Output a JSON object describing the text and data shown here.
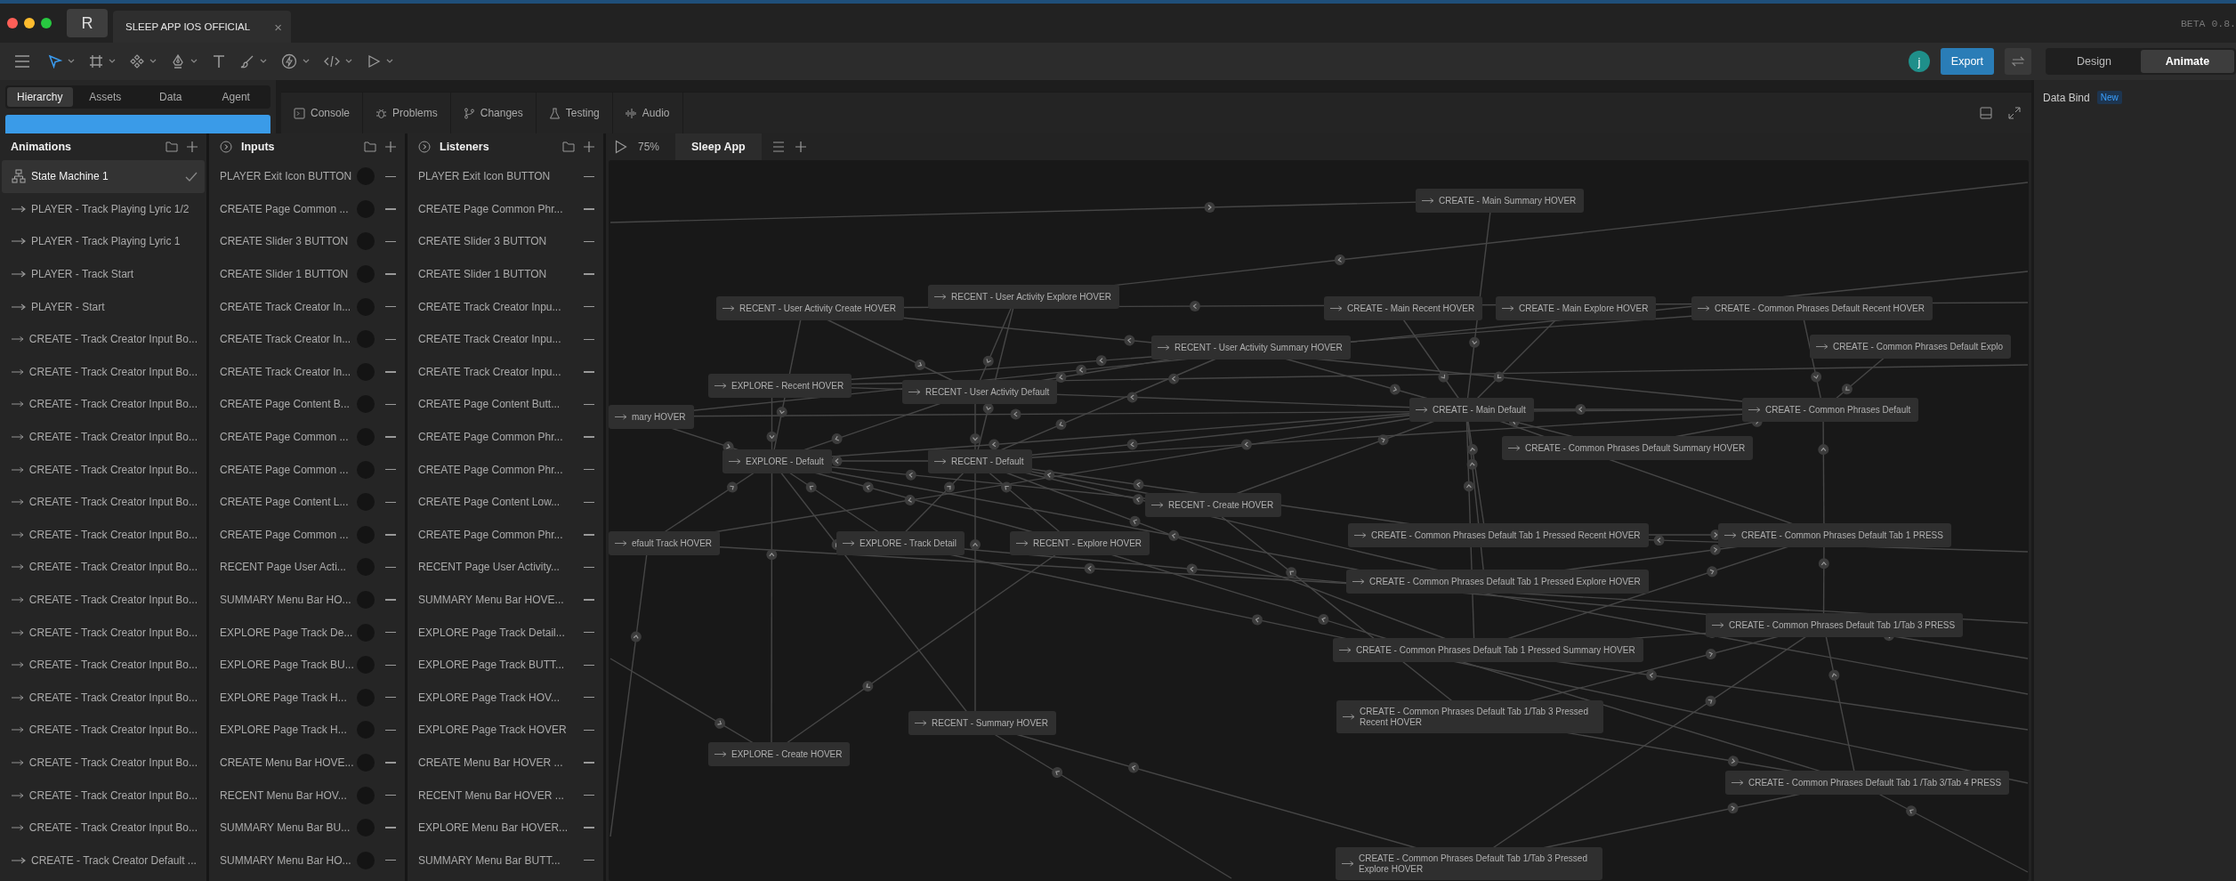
{
  "title_bar": {
    "logo": "R",
    "tab": {
      "title": "SLEEP APP IOS OFFICIAL",
      "close": "×"
    },
    "version": "BETA 0.8."
  },
  "toolbar": {
    "tools": [
      {
        "selected": true
      },
      {
        "selected": false
      },
      {
        "selected": false
      },
      {
        "selected": false
      },
      {
        "selected": false
      },
      {
        "selected": false
      },
      {
        "selected": false
      },
      {
        "selected": false
      },
      {
        "selected": false
      }
    ],
    "avatar": "j",
    "export": "Export",
    "mode_tabs": [
      {
        "label": "Design",
        "selected": false
      },
      {
        "label": "Animate",
        "selected": true
      }
    ]
  },
  "left_tabs": [
    {
      "label": "Hierarchy",
      "selected": true
    },
    {
      "label": "Assets",
      "selected": false
    },
    {
      "label": "Data",
      "selected": false
    },
    {
      "label": "Agent",
      "selected": false
    }
  ],
  "bottom_tabs": [
    "Console",
    "Problems",
    "Changes",
    "Testing",
    "Audio"
  ],
  "right_panel": {
    "title": "Data Bind",
    "badge": "New"
  },
  "animations": {
    "title": "Animations",
    "items": [
      {
        "label": "State Machine 1",
        "kind": "state-machine",
        "selected": true
      },
      {
        "label": "PLAYER - Track Playing Lyric 1/2",
        "kind": "timeline",
        "selected": false
      },
      {
        "label": "PLAYER - Track Playing Lyric 1",
        "kind": "timeline",
        "selected": false
      },
      {
        "label": "PLAYER - Track Start",
        "kind": "timeline",
        "selected": false
      },
      {
        "label": "PLAYER - Start",
        "kind": "timeline",
        "selected": false
      },
      {
        "label": "CREATE - Track Creator Input Bo...",
        "kind": "timeline",
        "selected": false
      },
      {
        "label": "CREATE - Track Creator Input Bo...",
        "kind": "timeline",
        "selected": false
      },
      {
        "label": "CREATE - Track Creator Input Bo...",
        "kind": "timeline",
        "selected": false
      },
      {
        "label": "CREATE - Track Creator Input Bo...",
        "kind": "timeline",
        "selected": false
      },
      {
        "label": "CREATE - Track Creator Input Bo...",
        "kind": "timeline",
        "selected": false
      },
      {
        "label": "CREATE - Track Creator Input Bo...",
        "kind": "timeline",
        "selected": false
      },
      {
        "label": "CREATE - Track Creator Input Bo...",
        "kind": "timeline",
        "selected": false
      },
      {
        "label": "CREATE - Track Creator Input Bo...",
        "kind": "timeline",
        "selected": false
      },
      {
        "label": "CREATE - Track Creator Input Bo...",
        "kind": "timeline",
        "selected": false
      },
      {
        "label": "CREATE - Track Creator Input Bo...",
        "kind": "timeline",
        "selected": false
      },
      {
        "label": "CREATE - Track Creator Input Bo...",
        "kind": "timeline",
        "selected": false
      },
      {
        "label": "CREATE - Track Creator Input Bo...",
        "kind": "timeline",
        "selected": false
      },
      {
        "label": "CREATE - Track Creator Input Bo...",
        "kind": "timeline",
        "selected": false
      },
      {
        "label": "CREATE - Track Creator Input Bo...",
        "kind": "timeline",
        "selected": false
      },
      {
        "label": "CREATE - Track Creator Input Bo...",
        "kind": "timeline",
        "selected": false
      },
      {
        "label": "CREATE - Track Creator Input Bo...",
        "kind": "timeline",
        "selected": false
      },
      {
        "label": "CREATE - Track Creator Default ...",
        "kind": "timeline",
        "selected": false
      }
    ]
  },
  "inputs": {
    "title": "Inputs",
    "items": [
      "PLAYER Exit Icon BUTTON",
      "CREATE Page Common ...",
      "CREATE Slider 3 BUTTON",
      "CREATE Slider 1 BUTTON",
      "CREATE Track Creator In...",
      "CREATE Track Creator In...",
      "CREATE Track Creator In...",
      "CREATE Page Content B...",
      "CREATE Page Common ...",
      "CREATE Page Common ...",
      "CREATE Page Content L...",
      "CREATE Page Common ...",
      "RECENT Page User Acti...",
      "SUMMARY Menu Bar HO...",
      "EXPLORE Page Track De...",
      "EXPLORE Page Track BU...",
      "EXPLORE Page Track H...",
      "EXPLORE Page Track H...",
      "CREATE Menu Bar HOVE...",
      "RECENT Menu Bar HOV...",
      "SUMMARY Menu Bar BU...",
      "SUMMARY Menu Bar HO..."
    ]
  },
  "listeners": {
    "title": "Listeners",
    "items": [
      "PLAYER Exit Icon BUTTON",
      "CREATE Page Common Phr...",
      "CREATE Slider 3 BUTTON",
      "CREATE Slider 1 BUTTON",
      "CREATE Track Creator Inpu...",
      "CREATE Track Creator Inpu...",
      "CREATE Track Creator Inpu...",
      "CREATE Page Content Butt...",
      "CREATE Page Common Phr...",
      "CREATE Page Common Phr...",
      "CREATE Page Content Low...",
      "CREATE Page Common Phr...",
      "RECENT Page User Activity...",
      "SUMMARY Menu Bar HOVE...",
      "EXPLORE Page Track Detail...",
      "EXPLORE Page Track BUTT...",
      "EXPLORE Page Track HOV...",
      "EXPLORE Page Track HOVER",
      "CREATE Menu Bar HOVER ...",
      "RECENT Menu Bar HOVER ...",
      "EXPLORE Menu Bar HOVER...",
      "SUMMARY Menu Bar BUTT..."
    ]
  },
  "canvas": {
    "zoom": "75%",
    "tab": "Sleep App",
    "nodes": [
      "CREATE - Main Summary HOVER",
      "RECENT - User Activity Explore HOVER",
      "RECENT - User Activity Create HOVER",
      "CREATE - Main Recent HOVER",
      "CREATE - Main Explore HOVER",
      "CREATE - Common Phrases Default Recent HOVER",
      "RECENT - User Activity Summary HOVER",
      "CREATE - Common Phrases Default Explo",
      "EXPLORE - Recent HOVER",
      "RECENT - User Activity Default",
      "mary HOVER",
      "CREATE - Main Default",
      "CREATE - Common Phrases Default",
      "CREATE - Common Phrases Default Summary HOVER",
      "EXPLORE - Default",
      "RECENT - Default",
      "RECENT - Create HOVER",
      "CREATE - Common Phrases Default Tab 1 Pressed Recent HOVER",
      "CREATE - Common Phrases Default Tab 1 PRESS",
      "efault Track HOVER",
      "EXPLORE - Track Detail",
      "RECENT - Explore HOVER",
      "CREATE - Common Phrases Default Tab 1 Pressed Explore HOVER",
      "CREATE - Common Phrases Default Tab 1/Tab 3 PRESS",
      "CREATE - Common Phrases Default Tab 1 Pressed Summary HOVER",
      "RECENT - Summary HOVER",
      "CREATE - Common Phrases Default Tab 1/Tab 3 Pressed Recent HOVER",
      "EXPLORE - Create HOVER",
      "CREATE - Common Phrases Default Tab 1 /Tab 3/Tab 4 PRESS",
      "CREATE - Common Phrases Default Tab 1/Tab 3 Pressed Explore HOVER"
    ]
  }
}
